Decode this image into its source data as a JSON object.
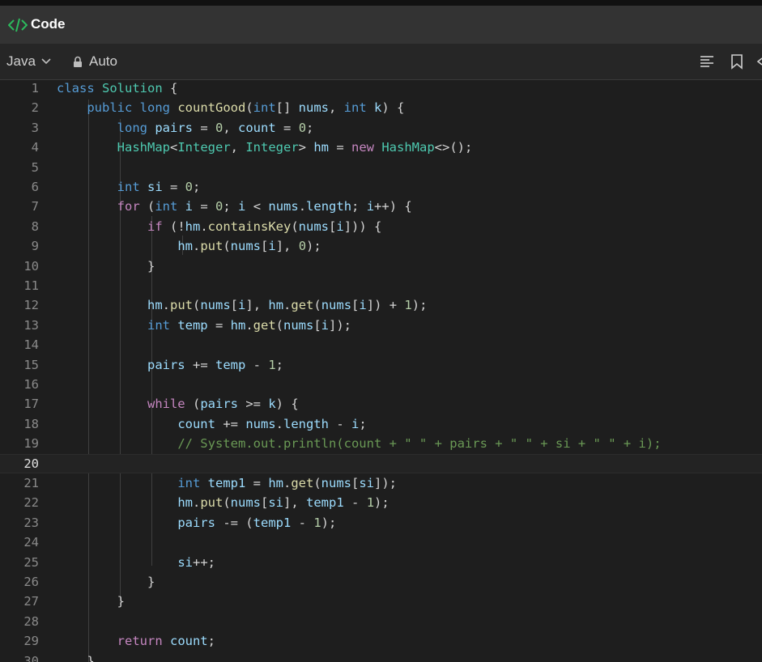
{
  "panel": {
    "title": "Code",
    "icon": "code-icon",
    "accent": "#2cbb5d"
  },
  "toolbar": {
    "language": "Java",
    "mode": "Auto",
    "icons": [
      "format-icon",
      "bookmark-icon",
      "chevron-left-icon"
    ]
  },
  "editor": {
    "lines": [
      {
        "n": "1",
        "tokens": [
          [
            "kw",
            "class "
          ],
          [
            "ty",
            "Solution"
          ],
          [
            "pl",
            " {"
          ]
        ]
      },
      {
        "n": "2",
        "tokens": [
          [
            "pl",
            "    "
          ],
          [
            "kw",
            "public "
          ],
          [
            "kw",
            "long "
          ],
          [
            "fn",
            "countGood"
          ],
          [
            "pl",
            "("
          ],
          [
            "kw",
            "int"
          ],
          [
            "pl",
            "[] "
          ],
          [
            "var",
            "nums"
          ],
          [
            "pl",
            ", "
          ],
          [
            "kw",
            "int "
          ],
          [
            "var",
            "k"
          ],
          [
            "pl",
            ") {"
          ]
        ]
      },
      {
        "n": "3",
        "tokens": [
          [
            "pl",
            "        "
          ],
          [
            "kw",
            "long "
          ],
          [
            "var",
            "pairs"
          ],
          [
            "pl",
            " = "
          ],
          [
            "num",
            "0"
          ],
          [
            "pl",
            ", "
          ],
          [
            "var",
            "count"
          ],
          [
            "pl",
            " = "
          ],
          [
            "num",
            "0"
          ],
          [
            "pl",
            ";"
          ]
        ]
      },
      {
        "n": "4",
        "tokens": [
          [
            "pl",
            "        "
          ],
          [
            "ty",
            "HashMap"
          ],
          [
            "pl",
            "<"
          ],
          [
            "ty",
            "Integer"
          ],
          [
            "pl",
            ", "
          ],
          [
            "ty",
            "Integer"
          ],
          [
            "pl",
            "> "
          ],
          [
            "var",
            "hm"
          ],
          [
            "pl",
            " = "
          ],
          [
            "ctl",
            "new "
          ],
          [
            "ty",
            "HashMap"
          ],
          [
            "pl",
            "<>();"
          ]
        ]
      },
      {
        "n": "5",
        "tokens": []
      },
      {
        "n": "6",
        "tokens": [
          [
            "pl",
            "        "
          ],
          [
            "kw",
            "int "
          ],
          [
            "var",
            "si"
          ],
          [
            "pl",
            " = "
          ],
          [
            "num",
            "0"
          ],
          [
            "pl",
            ";"
          ]
        ]
      },
      {
        "n": "7",
        "tokens": [
          [
            "pl",
            "        "
          ],
          [
            "ctl",
            "for "
          ],
          [
            "pl",
            "("
          ],
          [
            "kw",
            "int "
          ],
          [
            "var",
            "i"
          ],
          [
            "pl",
            " = "
          ],
          [
            "num",
            "0"
          ],
          [
            "pl",
            "; "
          ],
          [
            "var",
            "i"
          ],
          [
            "pl",
            " < "
          ],
          [
            "var",
            "nums"
          ],
          [
            "pl",
            "."
          ],
          [
            "var",
            "length"
          ],
          [
            "pl",
            "; "
          ],
          [
            "var",
            "i"
          ],
          [
            "pl",
            "++) {"
          ]
        ]
      },
      {
        "n": "8",
        "tokens": [
          [
            "pl",
            "            "
          ],
          [
            "ctl",
            "if "
          ],
          [
            "pl",
            "(!"
          ],
          [
            "var",
            "hm"
          ],
          [
            "pl",
            "."
          ],
          [
            "fn",
            "containsKey"
          ],
          [
            "pl",
            "("
          ],
          [
            "var",
            "nums"
          ],
          [
            "pl",
            "["
          ],
          [
            "var",
            "i"
          ],
          [
            "pl",
            "])) {"
          ]
        ]
      },
      {
        "n": "9",
        "tokens": [
          [
            "pl",
            "                "
          ],
          [
            "var",
            "hm"
          ],
          [
            "pl",
            "."
          ],
          [
            "fn",
            "put"
          ],
          [
            "pl",
            "("
          ],
          [
            "var",
            "nums"
          ],
          [
            "pl",
            "["
          ],
          [
            "var",
            "i"
          ],
          [
            "pl",
            "], "
          ],
          [
            "num",
            "0"
          ],
          [
            "pl",
            ");"
          ]
        ]
      },
      {
        "n": "10",
        "tokens": [
          [
            "pl",
            "            }"
          ]
        ]
      },
      {
        "n": "11",
        "tokens": []
      },
      {
        "n": "12",
        "tokens": [
          [
            "pl",
            "            "
          ],
          [
            "var",
            "hm"
          ],
          [
            "pl",
            "."
          ],
          [
            "fn",
            "put"
          ],
          [
            "pl",
            "("
          ],
          [
            "var",
            "nums"
          ],
          [
            "pl",
            "["
          ],
          [
            "var",
            "i"
          ],
          [
            "pl",
            "], "
          ],
          [
            "var",
            "hm"
          ],
          [
            "pl",
            "."
          ],
          [
            "fn",
            "get"
          ],
          [
            "pl",
            "("
          ],
          [
            "var",
            "nums"
          ],
          [
            "pl",
            "["
          ],
          [
            "var",
            "i"
          ],
          [
            "pl",
            "]) + "
          ],
          [
            "num",
            "1"
          ],
          [
            "pl",
            ");"
          ]
        ]
      },
      {
        "n": "13",
        "tokens": [
          [
            "pl",
            "            "
          ],
          [
            "kw",
            "int "
          ],
          [
            "var",
            "temp"
          ],
          [
            "pl",
            " = "
          ],
          [
            "var",
            "hm"
          ],
          [
            "pl",
            "."
          ],
          [
            "fn",
            "get"
          ],
          [
            "pl",
            "("
          ],
          [
            "var",
            "nums"
          ],
          [
            "pl",
            "["
          ],
          [
            "var",
            "i"
          ],
          [
            "pl",
            "]);"
          ]
        ]
      },
      {
        "n": "14",
        "tokens": []
      },
      {
        "n": "15",
        "tokens": [
          [
            "pl",
            "            "
          ],
          [
            "var",
            "pairs"
          ],
          [
            "pl",
            " += "
          ],
          [
            "var",
            "temp"
          ],
          [
            "pl",
            " - "
          ],
          [
            "num",
            "1"
          ],
          [
            "pl",
            ";"
          ]
        ]
      },
      {
        "n": "16",
        "tokens": []
      },
      {
        "n": "17",
        "tokens": [
          [
            "pl",
            "            "
          ],
          [
            "ctl",
            "while "
          ],
          [
            "pl",
            "("
          ],
          [
            "var",
            "pairs"
          ],
          [
            "pl",
            " >= "
          ],
          [
            "var",
            "k"
          ],
          [
            "pl",
            ") {"
          ]
        ]
      },
      {
        "n": "18",
        "tokens": [
          [
            "pl",
            "                "
          ],
          [
            "var",
            "count"
          ],
          [
            "pl",
            " += "
          ],
          [
            "var",
            "nums"
          ],
          [
            "pl",
            "."
          ],
          [
            "var",
            "length"
          ],
          [
            "pl",
            " - "
          ],
          [
            "var",
            "i"
          ],
          [
            "pl",
            ";"
          ]
        ]
      },
      {
        "n": "19",
        "tokens": [
          [
            "pl",
            "                "
          ],
          [
            "cm",
            "// System.out.println(count + \" \" + pairs + \" \" + si + \" \" + i);"
          ]
        ]
      },
      {
        "n": "20",
        "tokens": [],
        "active": true
      },
      {
        "n": "21",
        "tokens": [
          [
            "pl",
            "                "
          ],
          [
            "kw",
            "int "
          ],
          [
            "var",
            "temp1"
          ],
          [
            "pl",
            " = "
          ],
          [
            "var",
            "hm"
          ],
          [
            "pl",
            "."
          ],
          [
            "fn",
            "get"
          ],
          [
            "pl",
            "("
          ],
          [
            "var",
            "nums"
          ],
          [
            "pl",
            "["
          ],
          [
            "var",
            "si"
          ],
          [
            "pl",
            "]);"
          ]
        ]
      },
      {
        "n": "22",
        "tokens": [
          [
            "pl",
            "                "
          ],
          [
            "var",
            "hm"
          ],
          [
            "pl",
            "."
          ],
          [
            "fn",
            "put"
          ],
          [
            "pl",
            "("
          ],
          [
            "var",
            "nums"
          ],
          [
            "pl",
            "["
          ],
          [
            "var",
            "si"
          ],
          [
            "pl",
            "], "
          ],
          [
            "var",
            "temp1"
          ],
          [
            "pl",
            " - "
          ],
          [
            "num",
            "1"
          ],
          [
            "pl",
            ");"
          ]
        ]
      },
      {
        "n": "23",
        "tokens": [
          [
            "pl",
            "                "
          ],
          [
            "var",
            "pairs"
          ],
          [
            "pl",
            " -= ("
          ],
          [
            "var",
            "temp1"
          ],
          [
            "pl",
            " - "
          ],
          [
            "num",
            "1"
          ],
          [
            "pl",
            ");"
          ]
        ]
      },
      {
        "n": "24",
        "tokens": []
      },
      {
        "n": "25",
        "tokens": [
          [
            "pl",
            "                "
          ],
          [
            "var",
            "si"
          ],
          [
            "pl",
            "++;"
          ]
        ]
      },
      {
        "n": "26",
        "tokens": [
          [
            "pl",
            "            }"
          ]
        ]
      },
      {
        "n": "27",
        "tokens": [
          [
            "pl",
            "        }"
          ]
        ]
      },
      {
        "n": "28",
        "tokens": []
      },
      {
        "n": "29",
        "tokens": [
          [
            "pl",
            "        "
          ],
          [
            "ctl",
            "return "
          ],
          [
            "var",
            "count"
          ],
          [
            "pl",
            ";"
          ]
        ]
      },
      {
        "n": "30",
        "tokens": [
          [
            "pl",
            "    }"
          ]
        ]
      }
    ]
  }
}
